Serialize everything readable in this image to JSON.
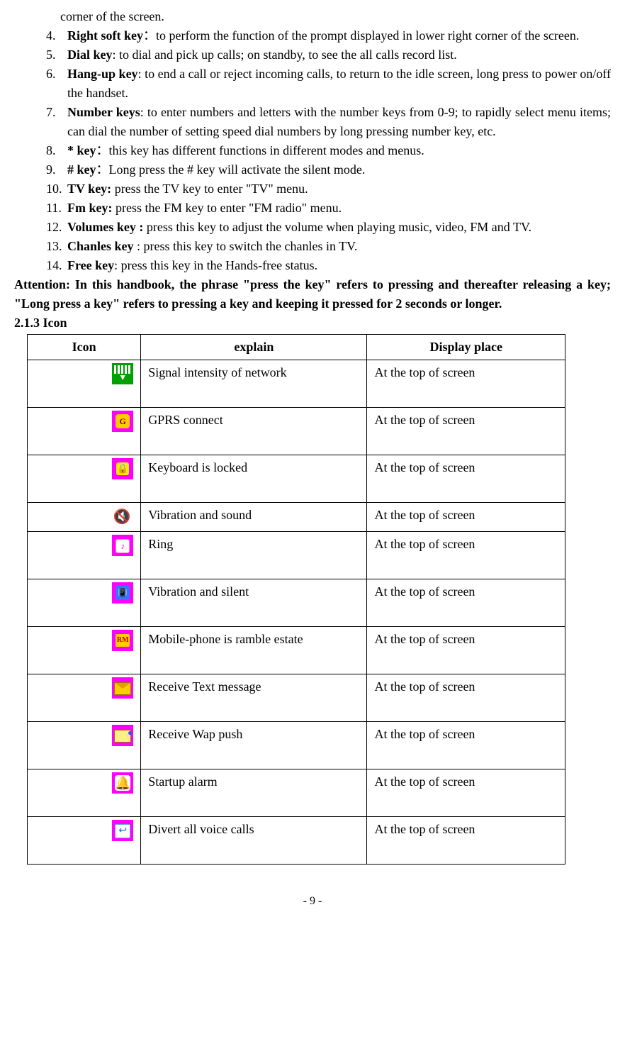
{
  "frag_top": "corner of the screen.",
  "list": [
    {
      "term": "Right soft key",
      "sep": "：",
      "desc": "to perform the function of the prompt displayed in lower right corner of the screen."
    },
    {
      "term": "Dial key",
      "sep": ": ",
      "desc": "to dial and pick up calls; on standby, to see the all calls record list."
    },
    {
      "term": "Hang-up key",
      "sep": ": ",
      "desc": "to end a call or reject incoming calls, to return to the idle screen, long press to power on/off the handset."
    },
    {
      "term": "Number keys",
      "sep": ": ",
      "desc": "to enter numbers and letters with the number keys from 0-9; to rapidly select menu items; can dial the number of setting speed dial numbers by long pressing number key, etc."
    },
    {
      "term": "* key",
      "sep": "：",
      "desc": "this key has different functions in different modes and menus."
    },
    {
      "term": "# key",
      "sep": "：",
      "desc": "Long press the # key will activate the silent mode."
    },
    {
      "term": "TV key:",
      "sep": " ",
      "desc": "press the TV key to enter \"TV\" menu."
    },
    {
      "term": "Fm key:",
      "sep": " ",
      "desc": "press the FM key to enter \"FM radio\" menu."
    },
    {
      "term": "Volumes key :",
      "sep": " ",
      "desc": "press this key to adjust the volume when playing music, video, FM and TV."
    },
    {
      "term": "Chanles key",
      "sep": " : ",
      "desc": "press this key to switch the chanles in TV."
    },
    {
      "term": "Free key",
      "sep": ": ",
      "desc": "press this key in the Hands-free status."
    }
  ],
  "attention": "Attention: In this handbook, the phrase \"press the key\" refers to pressing and thereafter releasing a key; \"Long press a key\" refers to pressing a key and keeping it pressed for 2 seconds or longer.",
  "subhead": "2.1.3 Icon",
  "table": {
    "headers": [
      "Icon",
      "explain",
      "Display place"
    ],
    "rows": [
      {
        "icon": "signal",
        "explain": "Signal intensity of network",
        "display": "At the top of screen",
        "tall": true
      },
      {
        "icon": "gprs",
        "explain": "GPRS connect",
        "display": "At the top of screen",
        "tall": true
      },
      {
        "icon": "lock",
        "explain": "Keyboard is locked",
        "display": "At the top of screen",
        "tall": true
      },
      {
        "icon": "vib",
        "explain": "Vibration and sound",
        "display": "At the top of screen",
        "tall": false
      },
      {
        "icon": "ring",
        "explain": "Ring",
        "display": "At the top of screen",
        "tall": true
      },
      {
        "icon": "vsil",
        "explain": "Vibration and silent",
        "display": "At the top of screen",
        "tall": true
      },
      {
        "icon": "rm",
        "explain": "Mobile-phone is ramble estate",
        "display": "At the top of screen",
        "tall": true
      },
      {
        "icon": "msg",
        "explain": "Receive Text message",
        "display": "At the top of screen",
        "tall": true
      },
      {
        "icon": "wap",
        "explain": "Receive Wap push",
        "display": "At the top of screen",
        "tall": true
      },
      {
        "icon": "alarm",
        "explain": "Startup alarm",
        "display": "At the top of screen",
        "tall": true
      },
      {
        "icon": "divert",
        "explain": "Divert all voice calls",
        "display": "At the top of screen",
        "tall": true
      }
    ]
  },
  "page_number": "- 9 -"
}
